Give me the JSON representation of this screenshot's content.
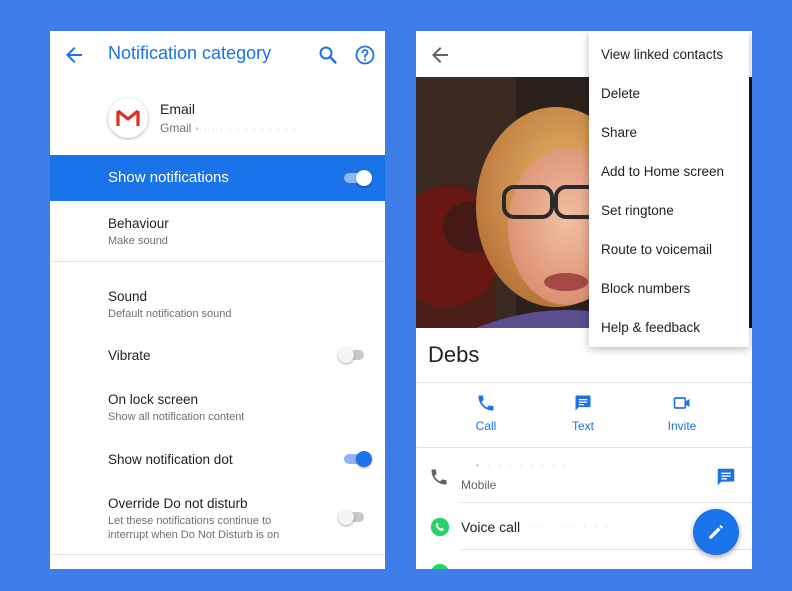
{
  "colors": {
    "background": "#3f7ee8",
    "accent": "#1a73e8",
    "whatsapp": "#25d366"
  },
  "left": {
    "title": "Notification category",
    "app": {
      "name": "Email",
      "sub": "Gmail"
    },
    "show_notifications": {
      "label": "Show notifications",
      "enabled": true
    },
    "rows": [
      {
        "title": "Behaviour",
        "sub": "Make sound"
      },
      {
        "title": "Sound",
        "sub": "Default notification sound"
      },
      {
        "title": "Vibrate",
        "toggle": false
      },
      {
        "title": "On lock screen",
        "sub": "Show all notification content"
      },
      {
        "title": "Show notification dot",
        "toggle": true
      },
      {
        "title": "Override Do not disturb",
        "sub_line1": "Let these notifications continue to",
        "sub_line2": "interrupt when Do Not Disturb is on",
        "toggle": false
      }
    ]
  },
  "right": {
    "contact_name": "Debs",
    "actions": [
      {
        "label": "Call",
        "icon": "phone-icon"
      },
      {
        "label": "Text",
        "icon": "message-icon"
      },
      {
        "label": "Invite",
        "icon": "video-icon"
      }
    ],
    "phone_row": {
      "sub": "Mobile"
    },
    "voice_row": {
      "label": "Voice call"
    },
    "menu": [
      "View linked contacts",
      "Delete",
      "Share",
      "Add to Home screen",
      "Set ringtone",
      "Route to voicemail",
      "Block numbers",
      "Help & feedback"
    ]
  }
}
